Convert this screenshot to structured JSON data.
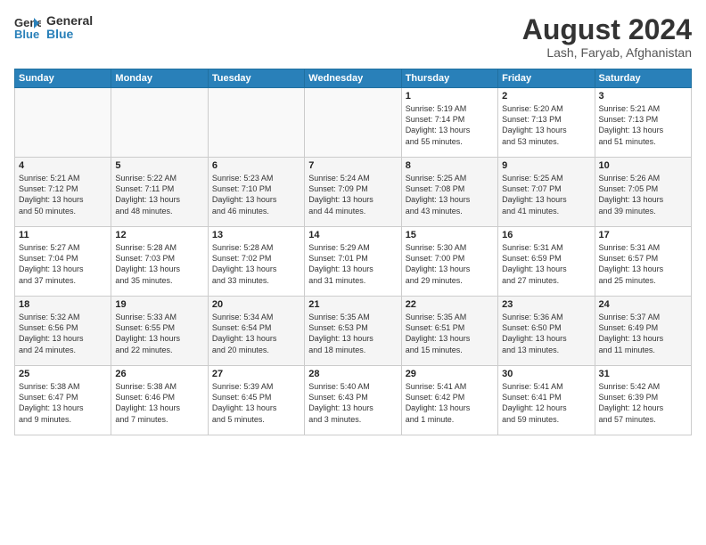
{
  "header": {
    "logo_line1": "General",
    "logo_line2": "Blue",
    "title": "August 2024",
    "subtitle": "Lash, Faryab, Afghanistan"
  },
  "days_of_week": [
    "Sunday",
    "Monday",
    "Tuesday",
    "Wednesday",
    "Thursday",
    "Friday",
    "Saturday"
  ],
  "weeks": [
    [
      {
        "num": "",
        "info": ""
      },
      {
        "num": "",
        "info": ""
      },
      {
        "num": "",
        "info": ""
      },
      {
        "num": "",
        "info": ""
      },
      {
        "num": "1",
        "info": "Sunrise: 5:19 AM\nSunset: 7:14 PM\nDaylight: 13 hours\nand 55 minutes."
      },
      {
        "num": "2",
        "info": "Sunrise: 5:20 AM\nSunset: 7:13 PM\nDaylight: 13 hours\nand 53 minutes."
      },
      {
        "num": "3",
        "info": "Sunrise: 5:21 AM\nSunset: 7:13 PM\nDaylight: 13 hours\nand 51 minutes."
      }
    ],
    [
      {
        "num": "4",
        "info": "Sunrise: 5:21 AM\nSunset: 7:12 PM\nDaylight: 13 hours\nand 50 minutes."
      },
      {
        "num": "5",
        "info": "Sunrise: 5:22 AM\nSunset: 7:11 PM\nDaylight: 13 hours\nand 48 minutes."
      },
      {
        "num": "6",
        "info": "Sunrise: 5:23 AM\nSunset: 7:10 PM\nDaylight: 13 hours\nand 46 minutes."
      },
      {
        "num": "7",
        "info": "Sunrise: 5:24 AM\nSunset: 7:09 PM\nDaylight: 13 hours\nand 44 minutes."
      },
      {
        "num": "8",
        "info": "Sunrise: 5:25 AM\nSunset: 7:08 PM\nDaylight: 13 hours\nand 43 minutes."
      },
      {
        "num": "9",
        "info": "Sunrise: 5:25 AM\nSunset: 7:07 PM\nDaylight: 13 hours\nand 41 minutes."
      },
      {
        "num": "10",
        "info": "Sunrise: 5:26 AM\nSunset: 7:05 PM\nDaylight: 13 hours\nand 39 minutes."
      }
    ],
    [
      {
        "num": "11",
        "info": "Sunrise: 5:27 AM\nSunset: 7:04 PM\nDaylight: 13 hours\nand 37 minutes."
      },
      {
        "num": "12",
        "info": "Sunrise: 5:28 AM\nSunset: 7:03 PM\nDaylight: 13 hours\nand 35 minutes."
      },
      {
        "num": "13",
        "info": "Sunrise: 5:28 AM\nSunset: 7:02 PM\nDaylight: 13 hours\nand 33 minutes."
      },
      {
        "num": "14",
        "info": "Sunrise: 5:29 AM\nSunset: 7:01 PM\nDaylight: 13 hours\nand 31 minutes."
      },
      {
        "num": "15",
        "info": "Sunrise: 5:30 AM\nSunset: 7:00 PM\nDaylight: 13 hours\nand 29 minutes."
      },
      {
        "num": "16",
        "info": "Sunrise: 5:31 AM\nSunset: 6:59 PM\nDaylight: 13 hours\nand 27 minutes."
      },
      {
        "num": "17",
        "info": "Sunrise: 5:31 AM\nSunset: 6:57 PM\nDaylight: 13 hours\nand 25 minutes."
      }
    ],
    [
      {
        "num": "18",
        "info": "Sunrise: 5:32 AM\nSunset: 6:56 PM\nDaylight: 13 hours\nand 24 minutes."
      },
      {
        "num": "19",
        "info": "Sunrise: 5:33 AM\nSunset: 6:55 PM\nDaylight: 13 hours\nand 22 minutes."
      },
      {
        "num": "20",
        "info": "Sunrise: 5:34 AM\nSunset: 6:54 PM\nDaylight: 13 hours\nand 20 minutes."
      },
      {
        "num": "21",
        "info": "Sunrise: 5:35 AM\nSunset: 6:53 PM\nDaylight: 13 hours\nand 18 minutes."
      },
      {
        "num": "22",
        "info": "Sunrise: 5:35 AM\nSunset: 6:51 PM\nDaylight: 13 hours\nand 15 minutes."
      },
      {
        "num": "23",
        "info": "Sunrise: 5:36 AM\nSunset: 6:50 PM\nDaylight: 13 hours\nand 13 minutes."
      },
      {
        "num": "24",
        "info": "Sunrise: 5:37 AM\nSunset: 6:49 PM\nDaylight: 13 hours\nand 11 minutes."
      }
    ],
    [
      {
        "num": "25",
        "info": "Sunrise: 5:38 AM\nSunset: 6:47 PM\nDaylight: 13 hours\nand 9 minutes."
      },
      {
        "num": "26",
        "info": "Sunrise: 5:38 AM\nSunset: 6:46 PM\nDaylight: 13 hours\nand 7 minutes."
      },
      {
        "num": "27",
        "info": "Sunrise: 5:39 AM\nSunset: 6:45 PM\nDaylight: 13 hours\nand 5 minutes."
      },
      {
        "num": "28",
        "info": "Sunrise: 5:40 AM\nSunset: 6:43 PM\nDaylight: 13 hours\nand 3 minutes."
      },
      {
        "num": "29",
        "info": "Sunrise: 5:41 AM\nSunset: 6:42 PM\nDaylight: 13 hours\nand 1 minute."
      },
      {
        "num": "30",
        "info": "Sunrise: 5:41 AM\nSunset: 6:41 PM\nDaylight: 12 hours\nand 59 minutes."
      },
      {
        "num": "31",
        "info": "Sunrise: 5:42 AM\nSunset: 6:39 PM\nDaylight: 12 hours\nand 57 minutes."
      }
    ]
  ]
}
